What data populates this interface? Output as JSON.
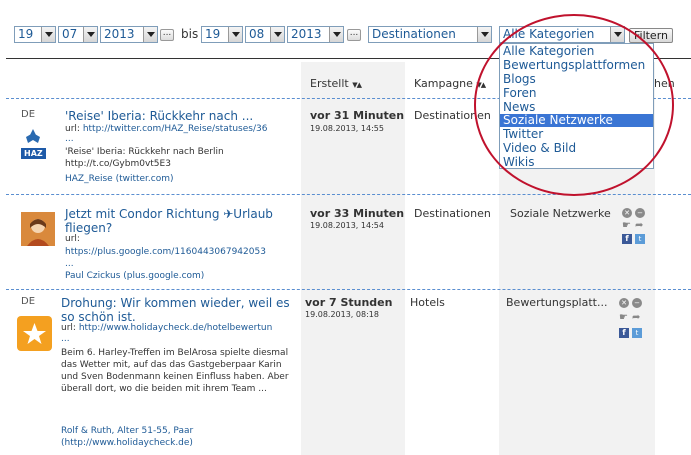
{
  "filters": {
    "from_day": "19",
    "from_month": "07",
    "from_year": "2013",
    "separator": "bis",
    "to_day": "19",
    "to_month": "08",
    "to_year": "2013",
    "campaign": "Destinationen",
    "category": "Alle Kategorien",
    "filter_button": "Filtern",
    "dots_button": "..."
  },
  "dropdown": {
    "options": [
      "Alle Kategorien",
      "Bewertungsplattformen",
      "Blogs",
      "Foren",
      "News",
      "Soziale Netzwerke",
      "Twitter",
      "Video & Bild",
      "Wikis"
    ],
    "highlighted": "Soziale Netzwerke"
  },
  "header": {
    "created": "Erstellt",
    "campaign": "Kampagne",
    "partial_hidden": "hen",
    "sort_arrows": "▼▲"
  },
  "rows": [
    {
      "lang": "DE",
      "avatar": "HAZ",
      "title": "'Reise' Iberia: Rückkehr nach ...",
      "url_label": "url:",
      "url": "http://twitter.com/HAZ_Reise/statuses/36",
      "url_cont": "...",
      "text": "'Reise' Iberia: Rückkehr nach Berlin http://t.co/Gybm0vt5E3",
      "author": "HAZ_Reise (twitter.com)",
      "when": "vor 31 Minuten",
      "date": "19.08.2013, 14:55",
      "campaign": "Destinationen"
    },
    {
      "lang": "",
      "title": "Jetzt mit Condor Richtung ✈Urlaub fliegen?",
      "url_label": "url:",
      "url": "https://plus.google.com/1160443067942053",
      "url_cont": "...",
      "author": "Paul Czickus (plus.google.com)",
      "when": "vor 33 Minuten",
      "date": "19.08.2013, 14:54",
      "campaign": "Destinationen",
      "category": "Soziale Netzwerke"
    },
    {
      "lang": "DE",
      "title": "Drohung: Wir kommen wieder, weil es so schön ist.",
      "url_label": "url:",
      "url": "http://www.holidaycheck.de/hotelbewertun",
      "url_cont": "...",
      "text": "Beim 6. Harley-Treffen im BelArosa spielte diesmal das Wetter mit, auf das das Gastgeberpaar Karin und Sven Bodenmann keinen Einfluss haben. Aber überall dort, wo die beiden mit ihrem Team ...",
      "author": "Rolf & Ruth, Alter 51-55, Paar (http://www.holidaycheck.de)",
      "when": "vor 7 Stunden",
      "date": "19.08.2013, 08:18",
      "campaign": "Hotels",
      "category": "Bewertungsplatt..."
    }
  ],
  "colors": {
    "link": "#1e5a96",
    "highlight": "#3a75d4",
    "annotation_circle": "#c0122d",
    "divider": "#5a8ed0"
  }
}
